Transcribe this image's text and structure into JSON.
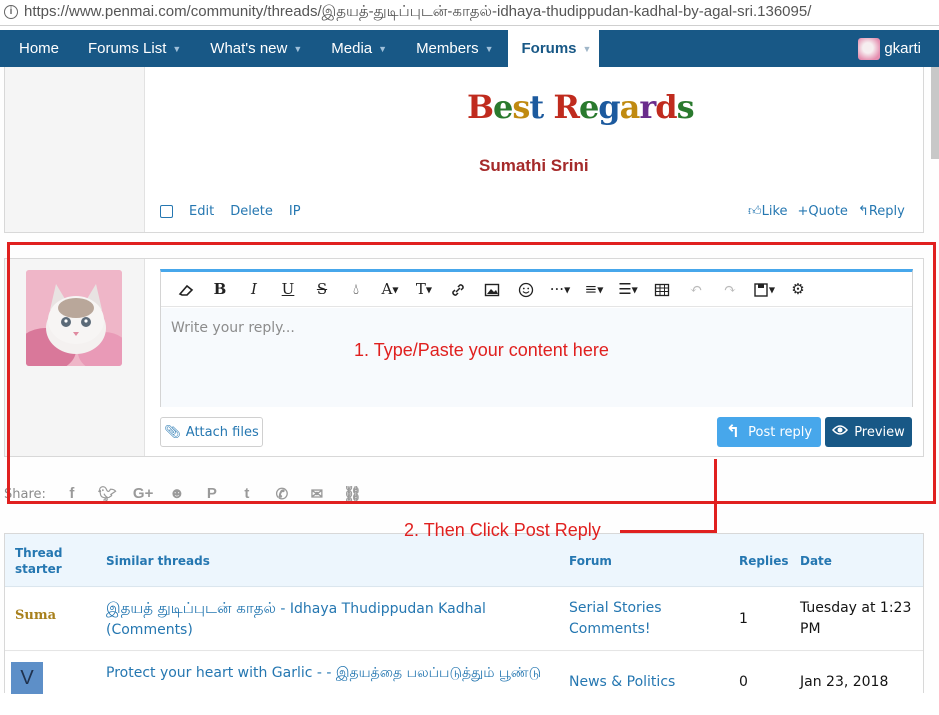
{
  "browser": {
    "url": "https://www.penmai.com/community/threads/இதயத்-துடிப்புடன்-காதல்-idhaya-thudippudan-kadhal-by-agal-sri.136095/"
  },
  "nav": {
    "items": [
      {
        "label": "Home",
        "has_caret": false
      },
      {
        "label": "Forums List",
        "has_caret": true
      },
      {
        "label": "What's new",
        "has_caret": true
      },
      {
        "label": "Media",
        "has_caret": true
      },
      {
        "label": "Members",
        "has_caret": true
      },
      {
        "label": "Forums",
        "has_caret": true,
        "active": true
      }
    ],
    "user": "gkarti"
  },
  "post": {
    "best_regards": "Best Regards",
    "signature": "Sumathi Srini",
    "actions_left": [
      "Edit",
      "Delete",
      "IP"
    ],
    "actions_right": {
      "like": "Like",
      "quote": "+Quote",
      "reply": "Reply"
    }
  },
  "editor": {
    "placeholder": "Write your reply...",
    "toolbar": [
      "eraser",
      "bold",
      "italic",
      "underline",
      "strike",
      "color",
      "font-size",
      "text-style",
      "link",
      "image",
      "smilie",
      "more",
      "align",
      "list",
      "table",
      "undo",
      "redo",
      "drafts",
      "settings"
    ]
  },
  "buttons": {
    "attach": "Attach files",
    "post_reply": "Post reply",
    "preview": "Preview"
  },
  "annotations": {
    "step1": "1. Type/Paste your content here",
    "step2": "2. Then Click Post Reply"
  },
  "share": {
    "label": "Share:"
  },
  "similar": {
    "headers": {
      "starter": "Thread starter",
      "title": "Similar threads",
      "forum": "Forum",
      "replies": "Replies",
      "date": "Date"
    },
    "rows": [
      {
        "starter": "Suma",
        "title_tamil": "இதயத் துடிப்புடன் காதல்",
        "title_rest": " - Idhaya Thudippudan Kadhal (Comments)",
        "forum": "Serial Stories Comments!",
        "replies": "1",
        "date": "Tuesday at 1:23 PM"
      },
      {
        "starter": "V",
        "title_tamil": "",
        "title_rest": "Protect your heart with Garlic - - இதயத்தை பலப்படுத்தும் பூண்டு",
        "forum": "News & Politics",
        "replies": "0",
        "date": "Jan 23, 2018"
      }
    ]
  },
  "colors": {
    "nav_bg": "#185886",
    "link": "#2577b1",
    "accent_blue": "#47a7eb",
    "annotation_red": "#e0201f",
    "signature": "#a52a2a"
  }
}
